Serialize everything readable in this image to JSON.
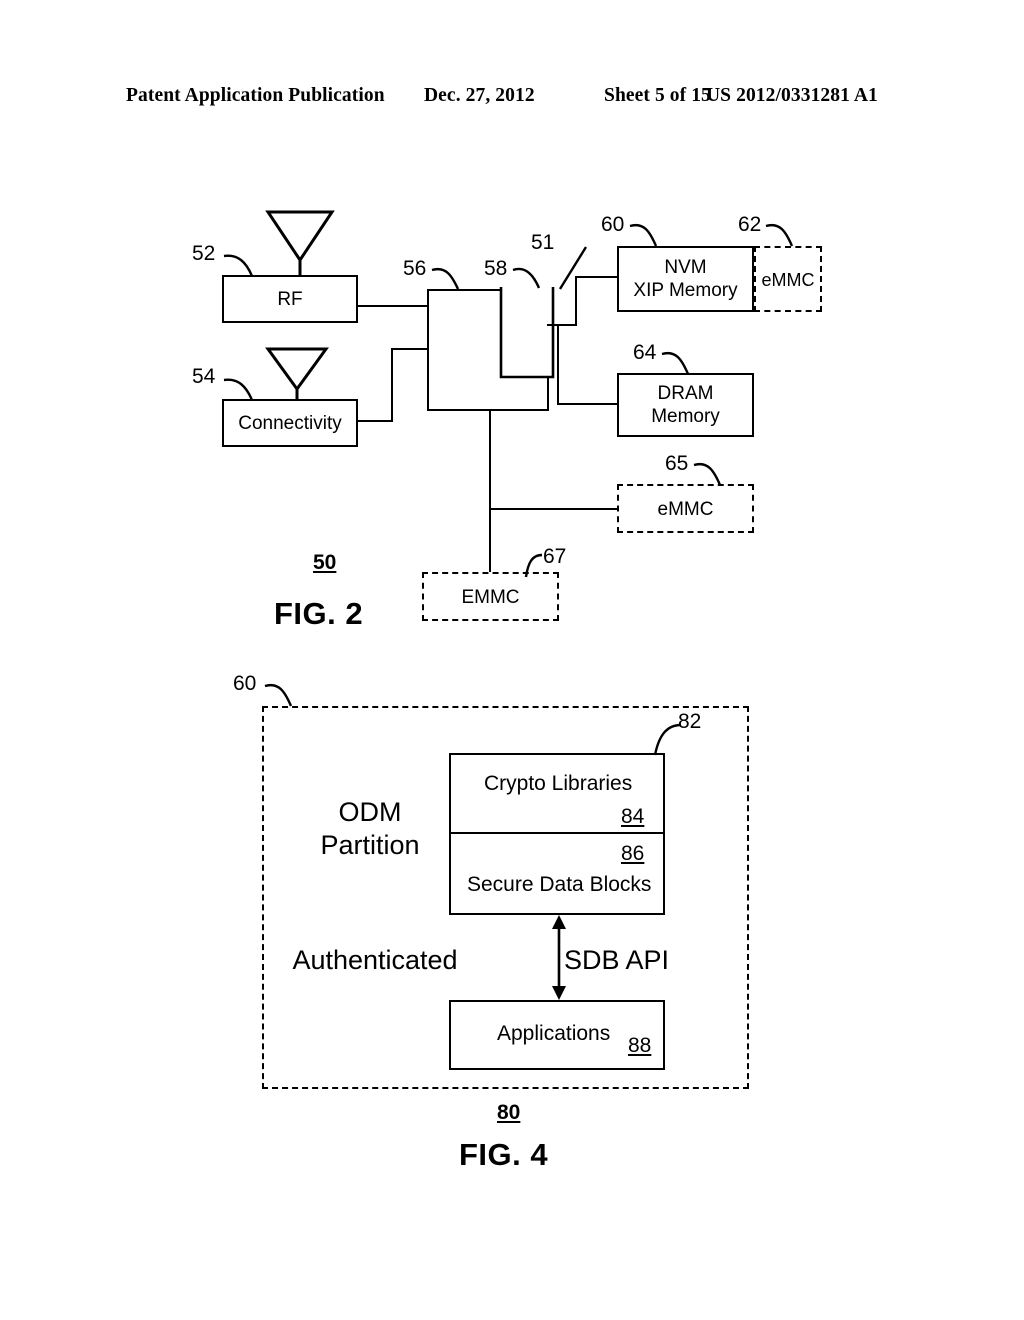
{
  "header": {
    "publication": "Patent Application Publication",
    "date": "Dec. 27, 2012",
    "sheet": "Sheet 5 of 15",
    "patent_number": "US 2012/0331281 A1"
  },
  "fig2": {
    "caption": "FIG. 2",
    "figure_ref": "50",
    "blocks": {
      "rf": {
        "label": "RF",
        "ref": "52"
      },
      "connectivity": {
        "label": "Connectivity",
        "ref": "54"
      },
      "cpu": {
        "label": "",
        "ref": "56"
      },
      "cpu_inner": {
        "label": "",
        "ref": "58"
      },
      "bus": {
        "ref": "51"
      },
      "nvm": {
        "label_line1": "NVM",
        "label_line2": "XIP Memory",
        "ref": "60"
      },
      "emmc_62": {
        "label": "eMMC",
        "ref": "62"
      },
      "dram": {
        "label_line1": "DRAM",
        "label_line2": "Memory",
        "ref": "64"
      },
      "emmc_65": {
        "label": "eMMC",
        "ref": "65"
      },
      "emmc_67": {
        "label": "EMMC",
        "ref": "67"
      }
    }
  },
  "fig4": {
    "caption": "FIG. 4",
    "figure_ref": "80",
    "outer": {
      "ref": "60"
    },
    "odm_partition": "ODM\nPartition",
    "odm_partition_line1": "ODM",
    "odm_partition_line2": "Partition",
    "authenticated": "Authenticated",
    "sdb_api": "SDB API",
    "stack": {
      "ref": "82"
    },
    "crypto_libraries": {
      "label": "Crypto Libraries",
      "ref": "84"
    },
    "secure_data_blocks": {
      "label": "Secure Data Blocks",
      "ref": "86"
    },
    "applications": {
      "label": "Applications",
      "ref": "88"
    }
  },
  "colors": {
    "ink": "#000000",
    "paper": "#ffffff"
  }
}
